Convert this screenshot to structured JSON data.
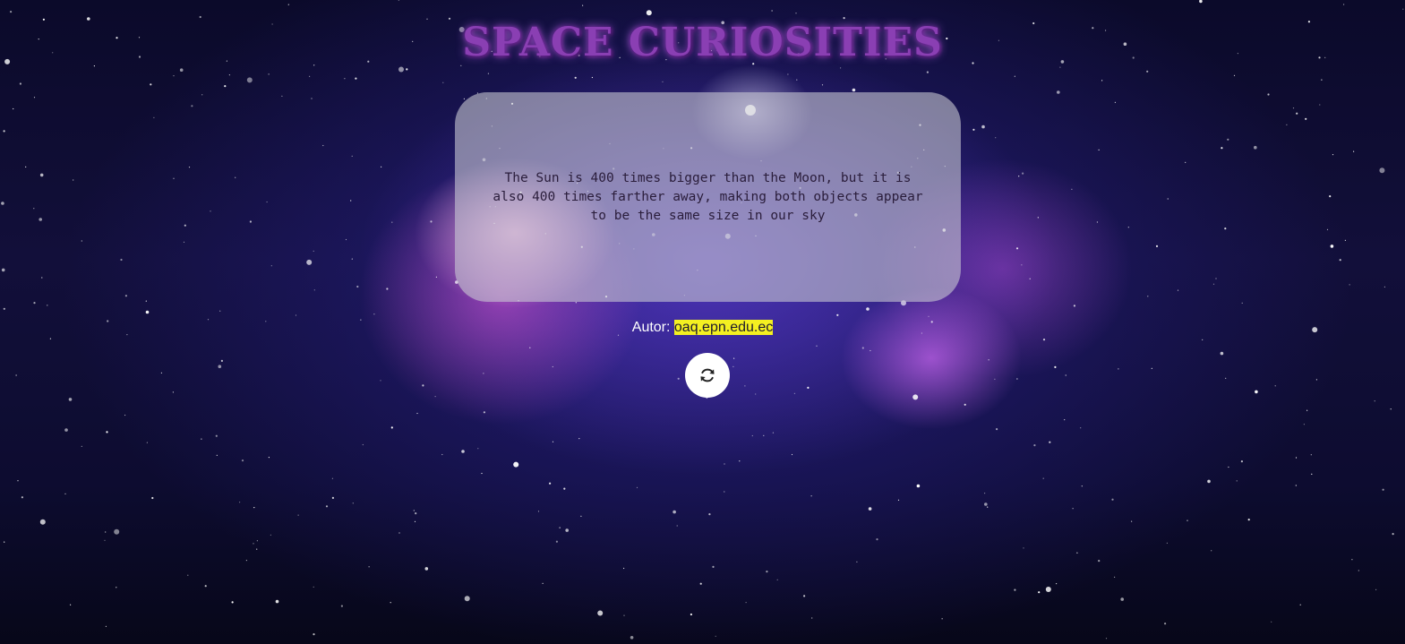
{
  "header": {
    "title": "SPACE CURIOSITIES"
  },
  "fact_card": {
    "text": "The Sun is 400 times bigger than the Moon, but it is also 400 times farther away, making both objects appear to be the same size in our sky"
  },
  "author": {
    "label": "Autor:",
    "link_text": "oaq.epn.edu.ec"
  },
  "controls": {
    "refresh_icon": "refresh-icon"
  },
  "colors": {
    "title": "#8a3fb3",
    "card_bg": "rgba(200,200,210,0.60)",
    "link_highlight": "#f4f021",
    "button_bg": "#ffffff"
  }
}
